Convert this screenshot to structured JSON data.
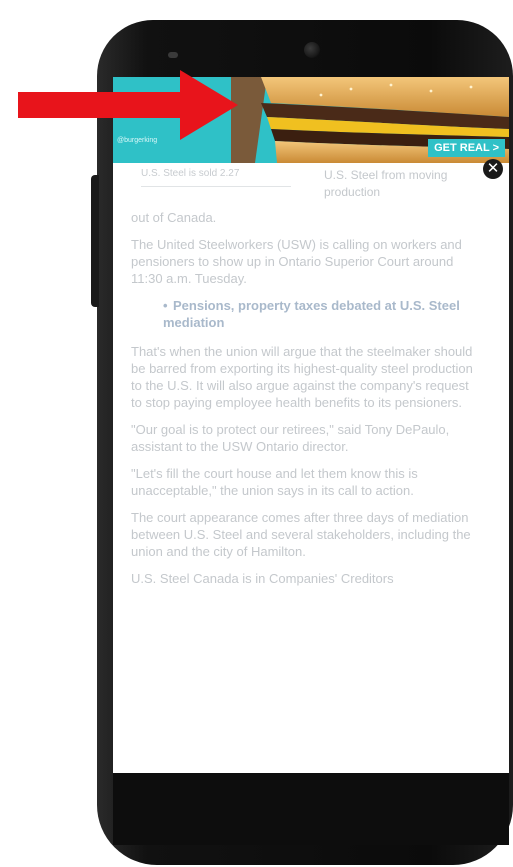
{
  "ad": {
    "logo_text": "",
    "tag_text": "@burgerking",
    "cta_label": "GET REAL >"
  },
  "article": {
    "caption_left": "U.S. Steel is sold 2.27",
    "caption_right": "U.S. Steel from moving production",
    "first_line": "out of Canada.",
    "para1": "The United Steelworkers (USW) is calling on workers and pensioners to show up in Ontario Superior Court around 11:30 a.m. Tuesday.",
    "related_link": "Pensions, property taxes debated at U.S. Steel mediation",
    "para2": "That's when the union will argue that the steelmaker should be barred from exporting its highest-quality steel production to the U.S. It will also argue against the company's request to stop paying employee health benefits to its pensioners.",
    "para3": "\"Our goal is to protect our retirees,\" said Tony DePaulo, assistant to the USW Ontario director.",
    "para4": "\"Let's fill the court house and let them know this is unacceptable,\" the union says in its call to action.",
    "para5": "The court appearance comes after three days of mediation between U.S. Steel and several stakeholders, including the union and the city of Hamilton.",
    "para6": "U.S. Steel Canada is in Companies' Creditors"
  },
  "colors": {
    "ad_teal": "#2fc1c7",
    "arrow_red": "#e8141b",
    "body_text": "#c4c8cc",
    "link_text": "#a9b9cb"
  },
  "icons": {
    "close": "close-icon",
    "arrow": "red-arrow-annotation"
  }
}
